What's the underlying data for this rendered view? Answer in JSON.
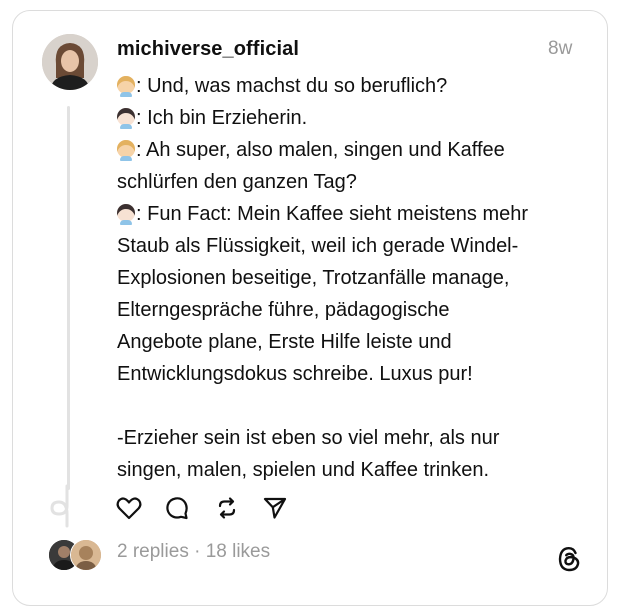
{
  "post": {
    "username": "michiverse_official",
    "timestamp": "8w",
    "lines": [
      ": Und, was machst du so beruflich?",
      ": Ich bin Erzieherin.",
      ": Ah super, also malen, singen und Kaffee",
      "schlürfen den ganzen Tag?",
      ": Fun Fact: Mein Kaffee sieht meistens mehr",
      "Staub als Flüssigkeit, weil ich gerade Windel-",
      "Explosionen beseitige, Trotzanfälle manage,",
      "Elterngespräche führe, pädagogische",
      "Angebote plane, Erste Hilfe leiste und",
      "Entwicklungsdokus schreibe. Luxus pur!",
      "-Erzieher sein ist eben so viel mehr, als nur",
      "singen, malen, spielen und Kaffee trinken."
    ],
    "emojis": [
      "woman-technologist-blonde",
      "woman-technologist-dark-hair",
      "woman-technologist-blonde",
      "woman-technologist-dark-hair"
    ]
  },
  "actions": {
    "icons": [
      "heart-icon",
      "comment-icon",
      "repost-icon",
      "share-icon"
    ]
  },
  "footer": {
    "stats": "2 replies · 18 likes",
    "logo": "threads-logo-icon"
  },
  "colors": {
    "text": "#101010",
    "muted": "#999999",
    "border": "#dcdcdc"
  }
}
